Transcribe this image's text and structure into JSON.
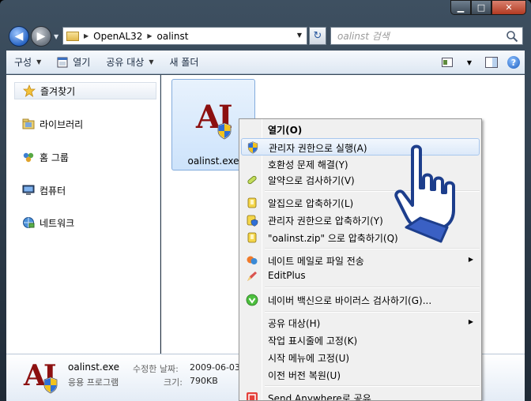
{
  "window": {
    "caption": {
      "minimize": "▁",
      "maximize": "□",
      "close": "✕"
    }
  },
  "nav": {
    "back_glyph": "◀",
    "forward_glyph": "▶",
    "breadcrumb": [
      "OpenAL32",
      "oalinst"
    ],
    "refresh_glyph": "↻",
    "search_placeholder": "oalinst 검색"
  },
  "toolbar": {
    "organize": "구성",
    "open": "열기",
    "share": "공유 대상",
    "new_folder": "새 폴더",
    "help": "?"
  },
  "sidebar": {
    "items": [
      {
        "label": "즐겨찾기",
        "icon": "star-icon"
      },
      {
        "label": "라이브러리",
        "icon": "library-icon"
      },
      {
        "label": "홈 그룹",
        "icon": "homegroup-icon"
      },
      {
        "label": "컴퓨터",
        "icon": "computer-icon"
      },
      {
        "label": "네트워크",
        "icon": "network-icon"
      }
    ]
  },
  "files": [
    {
      "name": "oalinst.exe",
      "icon": "oalinst-app-icon"
    }
  ],
  "details": {
    "name": "oalinst.exe",
    "type": "응용 프로그램",
    "date_label": "수정한 날짜:",
    "date_value": "2009-06-03",
    "size_label": "크기:",
    "size_value": "790KB"
  },
  "context_menu": {
    "items": [
      {
        "label": "열기(O)",
        "bold": true
      },
      {
        "label": "관리자 권한으로 실행(A)",
        "icon": "uac-shield-icon",
        "highlighted": true
      },
      {
        "label": "호환성 문제 해결(Y)"
      },
      {
        "label": "알약으로 검사하기(V)",
        "icon": "alyac-pill-icon"
      },
      {
        "label": "알집으로 압축하기(L)",
        "icon": "alzip-icon"
      },
      {
        "label": "관리자 권한으로 압축하기(Y)",
        "icon": "alzip-shield-icon"
      },
      {
        "label": "\"oalinst.zip\" 으로 압축하기(Q)",
        "icon": "alzip-icon"
      },
      {
        "label": "네이트 메일로 파일 전송",
        "icon": "nate-mail-icon",
        "submenu": true
      },
      {
        "label": "EditPlus",
        "icon": "editplus-icon"
      },
      {
        "label": "네이버 백신으로 바이러스 검사하기(G)...",
        "icon": "naver-vaccine-icon"
      },
      {
        "label": "공유 대상(H)",
        "submenu": true
      },
      {
        "label": "작업 표시줄에 고정(K)"
      },
      {
        "label": "시작 메뉴에 고정(U)"
      },
      {
        "label": "이전 버전 복원(U)"
      },
      {
        "label": "Send Anywhere로 공유",
        "icon": "send-anywhere-icon"
      }
    ],
    "submenu_glyph": "▶"
  },
  "logo_text": "AI",
  "colors": {
    "accent": "#2a66c4",
    "logo_red": "#8c1010",
    "hover_border": "#a8c7ee"
  }
}
